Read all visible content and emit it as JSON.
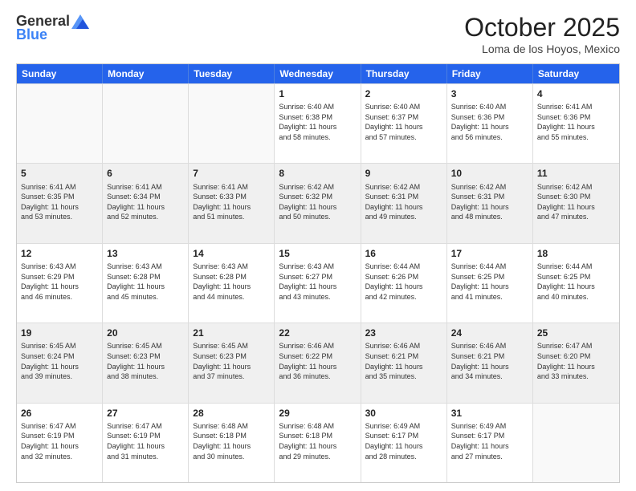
{
  "logo": {
    "general": "General",
    "blue": "Blue"
  },
  "header": {
    "month": "October 2025",
    "location": "Loma de los Hoyos, Mexico"
  },
  "weekdays": [
    "Sunday",
    "Monday",
    "Tuesday",
    "Wednesday",
    "Thursday",
    "Friday",
    "Saturday"
  ],
  "rows": [
    [
      {
        "day": "",
        "lines": []
      },
      {
        "day": "",
        "lines": []
      },
      {
        "day": "",
        "lines": []
      },
      {
        "day": "1",
        "lines": [
          "Sunrise: 6:40 AM",
          "Sunset: 6:38 PM",
          "Daylight: 11 hours",
          "and 58 minutes."
        ]
      },
      {
        "day": "2",
        "lines": [
          "Sunrise: 6:40 AM",
          "Sunset: 6:37 PM",
          "Daylight: 11 hours",
          "and 57 minutes."
        ]
      },
      {
        "day": "3",
        "lines": [
          "Sunrise: 6:40 AM",
          "Sunset: 6:36 PM",
          "Daylight: 11 hours",
          "and 56 minutes."
        ]
      },
      {
        "day": "4",
        "lines": [
          "Sunrise: 6:41 AM",
          "Sunset: 6:36 PM",
          "Daylight: 11 hours",
          "and 55 minutes."
        ]
      }
    ],
    [
      {
        "day": "5",
        "lines": [
          "Sunrise: 6:41 AM",
          "Sunset: 6:35 PM",
          "Daylight: 11 hours",
          "and 53 minutes."
        ]
      },
      {
        "day": "6",
        "lines": [
          "Sunrise: 6:41 AM",
          "Sunset: 6:34 PM",
          "Daylight: 11 hours",
          "and 52 minutes."
        ]
      },
      {
        "day": "7",
        "lines": [
          "Sunrise: 6:41 AM",
          "Sunset: 6:33 PM",
          "Daylight: 11 hours",
          "and 51 minutes."
        ]
      },
      {
        "day": "8",
        "lines": [
          "Sunrise: 6:42 AM",
          "Sunset: 6:32 PM",
          "Daylight: 11 hours",
          "and 50 minutes."
        ]
      },
      {
        "day": "9",
        "lines": [
          "Sunrise: 6:42 AM",
          "Sunset: 6:31 PM",
          "Daylight: 11 hours",
          "and 49 minutes."
        ]
      },
      {
        "day": "10",
        "lines": [
          "Sunrise: 6:42 AM",
          "Sunset: 6:31 PM",
          "Daylight: 11 hours",
          "and 48 minutes."
        ]
      },
      {
        "day": "11",
        "lines": [
          "Sunrise: 6:42 AM",
          "Sunset: 6:30 PM",
          "Daylight: 11 hours",
          "and 47 minutes."
        ]
      }
    ],
    [
      {
        "day": "12",
        "lines": [
          "Sunrise: 6:43 AM",
          "Sunset: 6:29 PM",
          "Daylight: 11 hours",
          "and 46 minutes."
        ]
      },
      {
        "day": "13",
        "lines": [
          "Sunrise: 6:43 AM",
          "Sunset: 6:28 PM",
          "Daylight: 11 hours",
          "and 45 minutes."
        ]
      },
      {
        "day": "14",
        "lines": [
          "Sunrise: 6:43 AM",
          "Sunset: 6:28 PM",
          "Daylight: 11 hours",
          "and 44 minutes."
        ]
      },
      {
        "day": "15",
        "lines": [
          "Sunrise: 6:43 AM",
          "Sunset: 6:27 PM",
          "Daylight: 11 hours",
          "and 43 minutes."
        ]
      },
      {
        "day": "16",
        "lines": [
          "Sunrise: 6:44 AM",
          "Sunset: 6:26 PM",
          "Daylight: 11 hours",
          "and 42 minutes."
        ]
      },
      {
        "day": "17",
        "lines": [
          "Sunrise: 6:44 AM",
          "Sunset: 6:25 PM",
          "Daylight: 11 hours",
          "and 41 minutes."
        ]
      },
      {
        "day": "18",
        "lines": [
          "Sunrise: 6:44 AM",
          "Sunset: 6:25 PM",
          "Daylight: 11 hours",
          "and 40 minutes."
        ]
      }
    ],
    [
      {
        "day": "19",
        "lines": [
          "Sunrise: 6:45 AM",
          "Sunset: 6:24 PM",
          "Daylight: 11 hours",
          "and 39 minutes."
        ]
      },
      {
        "day": "20",
        "lines": [
          "Sunrise: 6:45 AM",
          "Sunset: 6:23 PM",
          "Daylight: 11 hours",
          "and 38 minutes."
        ]
      },
      {
        "day": "21",
        "lines": [
          "Sunrise: 6:45 AM",
          "Sunset: 6:23 PM",
          "Daylight: 11 hours",
          "and 37 minutes."
        ]
      },
      {
        "day": "22",
        "lines": [
          "Sunrise: 6:46 AM",
          "Sunset: 6:22 PM",
          "Daylight: 11 hours",
          "and 36 minutes."
        ]
      },
      {
        "day": "23",
        "lines": [
          "Sunrise: 6:46 AM",
          "Sunset: 6:21 PM",
          "Daylight: 11 hours",
          "and 35 minutes."
        ]
      },
      {
        "day": "24",
        "lines": [
          "Sunrise: 6:46 AM",
          "Sunset: 6:21 PM",
          "Daylight: 11 hours",
          "and 34 minutes."
        ]
      },
      {
        "day": "25",
        "lines": [
          "Sunrise: 6:47 AM",
          "Sunset: 6:20 PM",
          "Daylight: 11 hours",
          "and 33 minutes."
        ]
      }
    ],
    [
      {
        "day": "26",
        "lines": [
          "Sunrise: 6:47 AM",
          "Sunset: 6:19 PM",
          "Daylight: 11 hours",
          "and 32 minutes."
        ]
      },
      {
        "day": "27",
        "lines": [
          "Sunrise: 6:47 AM",
          "Sunset: 6:19 PM",
          "Daylight: 11 hours",
          "and 31 minutes."
        ]
      },
      {
        "day": "28",
        "lines": [
          "Sunrise: 6:48 AM",
          "Sunset: 6:18 PM",
          "Daylight: 11 hours",
          "and 30 minutes."
        ]
      },
      {
        "day": "29",
        "lines": [
          "Sunrise: 6:48 AM",
          "Sunset: 6:18 PM",
          "Daylight: 11 hours",
          "and 29 minutes."
        ]
      },
      {
        "day": "30",
        "lines": [
          "Sunrise: 6:49 AM",
          "Sunset: 6:17 PM",
          "Daylight: 11 hours",
          "and 28 minutes."
        ]
      },
      {
        "day": "31",
        "lines": [
          "Sunrise: 6:49 AM",
          "Sunset: 6:17 PM",
          "Daylight: 11 hours",
          "and 27 minutes."
        ]
      },
      {
        "day": "",
        "lines": []
      }
    ]
  ]
}
